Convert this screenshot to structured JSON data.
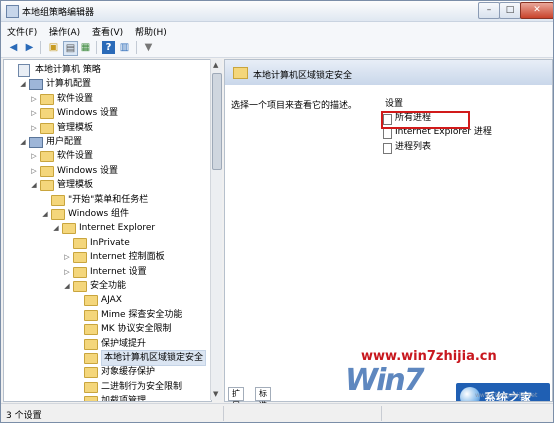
{
  "window": {
    "title": "本地组策略编辑器"
  },
  "menu": [
    {
      "label": "文件(F)"
    },
    {
      "label": "操作(A)"
    },
    {
      "label": "查看(V)"
    },
    {
      "label": "帮助(H)"
    }
  ],
  "toolbar": {
    "buttons": [
      "back-arrow-icon",
      "forward-arrow-icon",
      "up-folder-icon",
      "show-hide-tree-icon",
      "export-list-icon",
      "help-icon",
      "properties-icon",
      "filter-icon"
    ]
  },
  "tree": [
    {
      "label": "本地计算机 策略",
      "depth": 0,
      "arrow": "",
      "icon": "pol"
    },
    {
      "label": "计算机配置",
      "depth": 1,
      "arrow": "◢",
      "icon": "pc"
    },
    {
      "label": "软件设置",
      "depth": 2,
      "arrow": "▷",
      "icon": "folder"
    },
    {
      "label": "Windows 设置",
      "depth": 2,
      "arrow": "▷",
      "icon": "folder"
    },
    {
      "label": "管理模板",
      "depth": 2,
      "arrow": "▷",
      "icon": "folder"
    },
    {
      "label": "用户配置",
      "depth": 1,
      "arrow": "◢",
      "icon": "pc"
    },
    {
      "label": "软件设置",
      "depth": 2,
      "arrow": "▷",
      "icon": "folder"
    },
    {
      "label": "Windows 设置",
      "depth": 2,
      "arrow": "▷",
      "icon": "folder"
    },
    {
      "label": "管理模板",
      "depth": 2,
      "arrow": "◢",
      "icon": "folder"
    },
    {
      "label": "\"开始\"菜单和任务栏",
      "depth": 3,
      "arrow": "",
      "icon": "folder"
    },
    {
      "label": "Windows 组件",
      "depth": 3,
      "arrow": "◢",
      "icon": "folder"
    },
    {
      "label": "Internet Explorer",
      "depth": 4,
      "arrow": "◢",
      "icon": "folder"
    },
    {
      "label": "InPrivate",
      "depth": 5,
      "arrow": "",
      "icon": "folder"
    },
    {
      "label": "Internet 控制面板",
      "depth": 5,
      "arrow": "▷",
      "icon": "folder"
    },
    {
      "label": "Internet 设置",
      "depth": 5,
      "arrow": "▷",
      "icon": "folder"
    },
    {
      "label": "安全功能",
      "depth": 5,
      "arrow": "◢",
      "icon": "folder"
    },
    {
      "label": "AJAX",
      "depth": 6,
      "arrow": "",
      "icon": "folder"
    },
    {
      "label": "Mime 探查安全功能",
      "depth": 6,
      "arrow": "",
      "icon": "folder"
    },
    {
      "label": "MK 协议安全限制",
      "depth": 6,
      "arrow": "",
      "icon": "folder"
    },
    {
      "label": "保护域提升",
      "depth": 6,
      "arrow": "",
      "icon": "folder"
    },
    {
      "label": "本地计算机区域锁定安全",
      "depth": 6,
      "arrow": "",
      "icon": "folder",
      "selected": true
    },
    {
      "label": "对象缓存保护",
      "depth": 6,
      "arrow": "",
      "icon": "folder"
    },
    {
      "label": "二进制行为安全限制",
      "depth": 6,
      "arrow": "",
      "icon": "folder"
    },
    {
      "label": "加载项管理",
      "depth": 6,
      "arrow": "",
      "icon": "folder"
    }
  ],
  "right": {
    "header_title": "本地计算机区域锁定安全",
    "description": "选择一个项目来查看它的描述。",
    "settings_title": "设置",
    "settings": [
      "所有进程",
      "Internet Explorer 进程",
      "进程列表"
    ]
  },
  "tabs": [
    "扩展",
    "标准"
  ],
  "watermark": {
    "url": "www.win7zhijia.cn",
    "brand": "Win7",
    "badge": "系统之家",
    "small": "www.xitongzhijia.net"
  },
  "status": {
    "text": "3 个设置"
  }
}
